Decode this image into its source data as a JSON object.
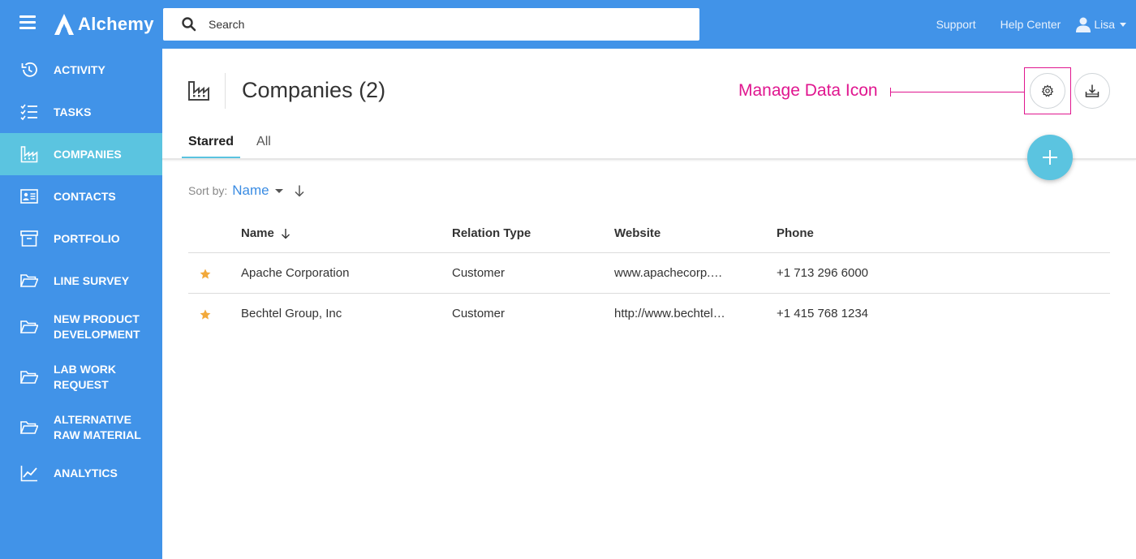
{
  "app": {
    "name": "Alchemy",
    "search_placeholder": "Search"
  },
  "topbar": {
    "support": "Support",
    "help_center": "Help Center",
    "user_name": "Lisa"
  },
  "sidebar": {
    "items": [
      {
        "label": "ACTIVITY",
        "icon": "history-icon"
      },
      {
        "label": "TASKS",
        "icon": "checklist-icon"
      },
      {
        "label": "COMPANIES",
        "icon": "factory-icon",
        "active": true
      },
      {
        "label": "CONTACTS",
        "icon": "contact-card-icon"
      },
      {
        "label": "PORTFOLIO",
        "icon": "archive-box-icon"
      },
      {
        "label": "LINE SURVEY",
        "icon": "folder-open-icon"
      },
      {
        "label": "NEW PRODUCT DEVELOPMENT",
        "icon": "folder-open-icon"
      },
      {
        "label": "LAB WORK REQUEST",
        "icon": "folder-open-icon"
      },
      {
        "label": "ALTERNATIVE RAW MATERIAL",
        "icon": "folder-open-icon"
      },
      {
        "label": "ANALYTICS",
        "icon": "line-chart-icon"
      }
    ]
  },
  "page": {
    "title": "Companies (2)",
    "annotation": "Manage Data Icon",
    "tabs": [
      {
        "label": "Starred",
        "active": true
      },
      {
        "label": "All",
        "active": false
      }
    ],
    "sort_label": "Sort by:",
    "sort_value": "Name"
  },
  "table": {
    "columns": [
      "Name",
      "Relation Type",
      "Website",
      "Phone"
    ],
    "rows": [
      {
        "name": "Apache Corporation",
        "relation": "Customer",
        "website": "www.apachecorp.c…",
        "phone": "+1 713 296 6000",
        "starred": true
      },
      {
        "name": "Bechtel Group, Inc",
        "relation": "Customer",
        "website": "http://www.bechtel…",
        "phone": "+1 415 768 1234",
        "starred": true
      }
    ]
  },
  "colors": {
    "primary": "#4193e8",
    "accent": "#5bc4e0",
    "annotation": "#e0168f",
    "star": "#f2a93b"
  }
}
